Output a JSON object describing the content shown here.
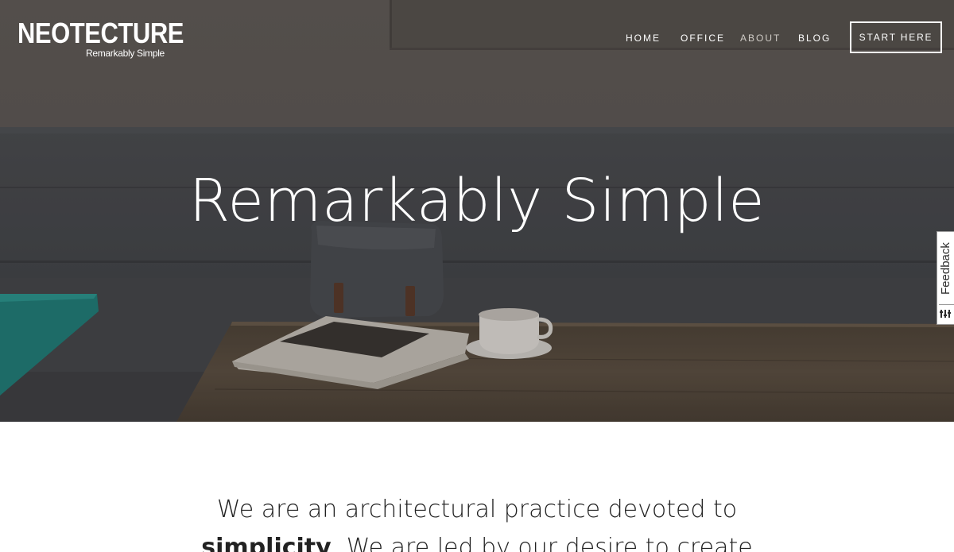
{
  "brand": {
    "name": "NEOTECTURE",
    "tagline": "Remarkably Simple"
  },
  "nav": {
    "items": [
      {
        "label": "HOME",
        "active": false
      },
      {
        "label": "OFFICE",
        "active": false
      },
      {
        "label": "ABOUT",
        "active": true
      },
      {
        "label": "BLOG",
        "active": false
      }
    ],
    "cta_label": "START HERE"
  },
  "hero": {
    "title": "Remarkably Simple"
  },
  "feedback": {
    "label": "Feedback",
    "icon": "feedback-icon"
  },
  "intro": {
    "line1": "We are an architectural practice devoted to",
    "line2_bold": "simplicity",
    "line2_rest": ". We are led by our desire to create"
  },
  "colors": {
    "nav_active": "#cfcbc6",
    "text_dark": "#222222",
    "accent_teal": "#1f8c86"
  }
}
